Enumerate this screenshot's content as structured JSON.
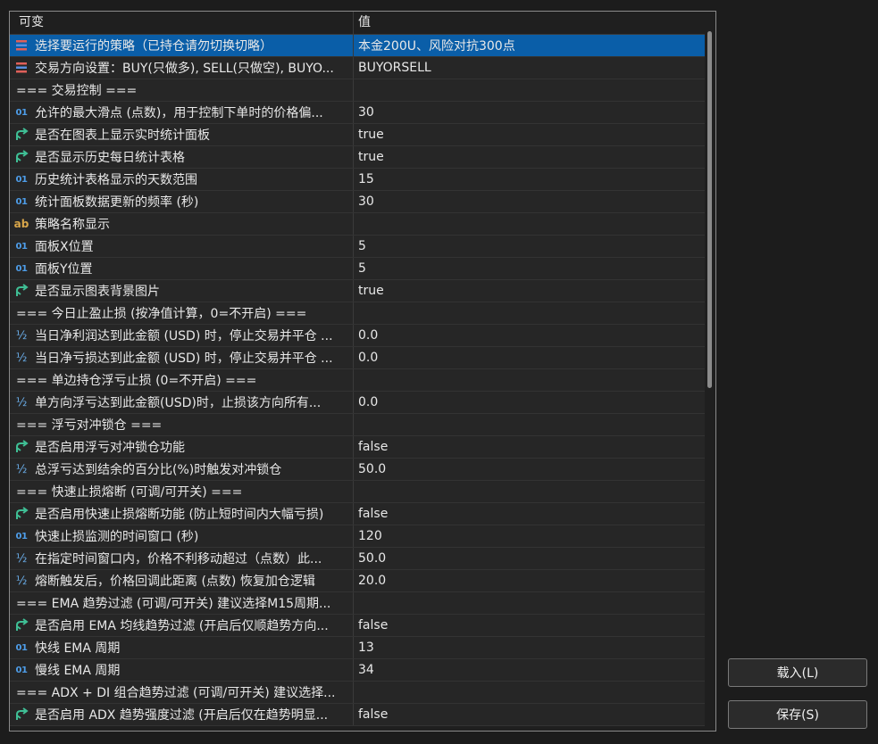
{
  "header": {
    "col_name": "可变",
    "col_value": "值"
  },
  "rows": [
    {
      "icon": "enum-icon",
      "label": "选择要运行的策略（已持仓请勿切换切略）",
      "value": "本金200U、风险对抗300点",
      "selected": true
    },
    {
      "icon": "enum-icon",
      "label": "交易方向设置：BUY(只做多), SELL(只做空), BUYO...",
      "value": "BUYORSELL"
    },
    {
      "icon": "",
      "label": "=== 交易控制 ===",
      "value": ""
    },
    {
      "icon": "int-icon",
      "label": "允许的最大滑点 (点数)，用于控制下单时的价格偏...",
      "value": "30"
    },
    {
      "icon": "bool-icon",
      "label": "是否在图表上显示实时统计面板",
      "value": "true"
    },
    {
      "icon": "bool-icon",
      "label": "是否显示历史每日统计表格",
      "value": "true"
    },
    {
      "icon": "int-icon",
      "label": "历史统计表格显示的天数范围",
      "value": "15"
    },
    {
      "icon": "int-icon",
      "label": "统计面板数据更新的频率 (秒)",
      "value": "30"
    },
    {
      "icon": "string-icon",
      "label": "策略名称显示",
      "value": ""
    },
    {
      "icon": "int-icon",
      "label": "面板X位置",
      "value": "5"
    },
    {
      "icon": "int-icon",
      "label": "面板Y位置",
      "value": "5"
    },
    {
      "icon": "bool-icon",
      "label": "是否显示图表背景图片",
      "value": "true"
    },
    {
      "icon": "",
      "label": "=== 今日止盈止损 (按净值计算，0=不开启) ===",
      "value": ""
    },
    {
      "icon": "double-icon",
      "label": "当日净利润达到此金额 (USD) 时，停止交易并平仓 ...",
      "value": "0.0"
    },
    {
      "icon": "double-icon",
      "label": "当日净亏损达到此金额 (USD) 时，停止交易并平仓 ...",
      "value": "0.0"
    },
    {
      "icon": "",
      "label": "=== 单边持仓浮亏止损 (0=不开启) ===",
      "value": ""
    },
    {
      "icon": "double-icon",
      "label": "单方向浮亏达到此金额(USD)时，止损该方向所有...",
      "value": "0.0"
    },
    {
      "icon": "",
      "label": "=== 浮亏对冲锁仓 ===",
      "value": ""
    },
    {
      "icon": "bool-icon",
      "label": "是否启用浮亏对冲锁仓功能",
      "value": "false"
    },
    {
      "icon": "double-icon",
      "label": "总浮亏达到结余的百分比(%)时触发对冲锁仓",
      "value": "50.0"
    },
    {
      "icon": "",
      "label": "=== 快速止损熔断 (可调/可开关) ===",
      "value": ""
    },
    {
      "icon": "bool-icon",
      "label": "是否启用快速止损熔断功能 (防止短时间内大幅亏损)",
      "value": "false"
    },
    {
      "icon": "int-icon",
      "label": "快速止损监测的时间窗口 (秒)",
      "value": "120"
    },
    {
      "icon": "double-icon",
      "label": "在指定时间窗口内，价格不利移动超过（点数）此...",
      "value": "50.0"
    },
    {
      "icon": "double-icon",
      "label": "熔断触发后，价格回调此距离 (点数) 恢复加仓逻辑",
      "value": "20.0"
    },
    {
      "icon": "",
      "label": "===  EMA 趋势过滤 (可调/可开关) 建议选择M15周期...",
      "value": ""
    },
    {
      "icon": "bool-icon",
      "label": "是否启用 EMA 均线趋势过滤 (开启后仅顺趋势方向...",
      "value": "false"
    },
    {
      "icon": "int-icon",
      "label": "快线 EMA 周期",
      "value": "13"
    },
    {
      "icon": "int-icon",
      "label": "慢线 EMA 周期",
      "value": "34"
    },
    {
      "icon": "",
      "label": "=== ADX + DI 组合趋势过滤 (可调/可开关) 建议选择...",
      "value": ""
    },
    {
      "icon": "bool-icon",
      "label": "是否启用 ADX 趋势强度过滤 (开启后仅在趋势明显...",
      "value": "false"
    }
  ],
  "buttons": {
    "load": "载入(L)",
    "save": "保存(S)"
  },
  "colors": {
    "selected_row": "#0a5ea8",
    "int_icon": "#4e9de8",
    "bool_icon": "#3fbf95",
    "string_icon": "#d8a64a"
  }
}
